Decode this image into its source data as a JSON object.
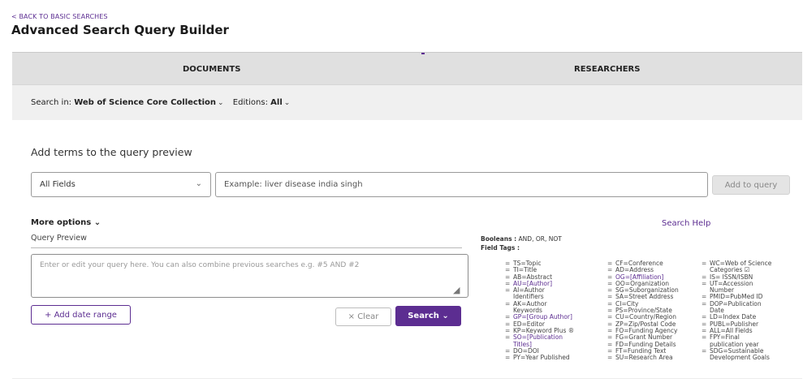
{
  "header": {
    "back_link": "< BACK TO BASIC SEARCHES",
    "title": "Advanced Search Query Builder"
  },
  "tabs": [
    {
      "label": "DOCUMENTS",
      "selected": true
    },
    {
      "label": "RESEARCHERS",
      "selected": false
    }
  ],
  "search_in": {
    "label": "Search in:",
    "collection": "Web of Science Core Collection",
    "editions_label": "Editions:",
    "editions_value": "All"
  },
  "add_terms": {
    "heading": "Add terms to the query preview",
    "field_select": "All Fields",
    "input_placeholder": "Example: liver disease india singh",
    "add_button": "Add to query"
  },
  "more_options": "More options",
  "search_help": "Search Help",
  "query_preview": {
    "label": "Query Preview",
    "placeholder": "Enter or edit your query here. You can also combine previous searches e.g. #5 AND #2"
  },
  "buttons": {
    "add_date_range": "+ Add date range",
    "clear": "× Clear",
    "search": "Search"
  },
  "booleans": {
    "label": "Booleans :",
    "values": "AND, OR, NOT"
  },
  "field_tags_label": "Field Tags :",
  "field_tags": {
    "col1": [
      {
        "text": "TS=Topic"
      },
      {
        "text": "TI=Title"
      },
      {
        "text": "AB=Abstract"
      },
      {
        "text": "AU=[Author]",
        "link": true
      },
      {
        "text": "AI=Author"
      },
      {
        "text": "Identifiers",
        "cont": true
      },
      {
        "text": "AK=Author"
      },
      {
        "text": "Keywords",
        "cont": true
      },
      {
        "text": "GP=[Group Author]",
        "link": true
      },
      {
        "text": "ED=Editor"
      },
      {
        "text": "KP=Keyword Plus ®"
      },
      {
        "text": "SO=[Publication",
        "link": true
      },
      {
        "text": "Titles]",
        "cont": true,
        "link": true
      },
      {
        "text": "DO=DOI"
      },
      {
        "text": "PY=Year Published"
      }
    ],
    "col2": [
      {
        "text": "CF=Conference"
      },
      {
        "text": "AD=Address"
      },
      {
        "text": "OG=[Affiliation]",
        "link": true
      },
      {
        "text": "OO=Organization"
      },
      {
        "text": "SG=Suborganization"
      },
      {
        "text": "SA=Street Address"
      },
      {
        "text": "CI=City"
      },
      {
        "text": "PS=Province/State"
      },
      {
        "text": "CU=Country/Region"
      },
      {
        "text": "ZP=Zip/Postal Code"
      },
      {
        "text": "FO=Funding Agency"
      },
      {
        "text": "FG=Grant Number"
      },
      {
        "text": "FD=Funding Details"
      },
      {
        "text": "FT=Funding Text"
      },
      {
        "text": "SU=Research Area"
      }
    ],
    "col3": [
      {
        "text": "WC=Web of Science"
      },
      {
        "text": "Categories ☑",
        "cont": true
      },
      {
        "text": "IS= ISSN/ISBN"
      },
      {
        "text": "UT=Accession"
      },
      {
        "text": "Number",
        "cont": true
      },
      {
        "text": "PMID=PubMed ID"
      },
      {
        "text": "DOP=Publication"
      },
      {
        "text": "Date",
        "cont": true
      },
      {
        "text": "LD=Index Date"
      },
      {
        "text": "PUBL=Publisher"
      },
      {
        "text": "ALL=All Fields"
      },
      {
        "text": "FPY=Final"
      },
      {
        "text": "publication year",
        "cont": true
      },
      {
        "text": "SDG=Sustainable"
      },
      {
        "text": "Development Goals",
        "cont": true
      }
    ]
  },
  "colors": {
    "accent": "#5c2d91",
    "tab_bar": "#e0e0e0",
    "search_bar": "#f0f0f0"
  }
}
